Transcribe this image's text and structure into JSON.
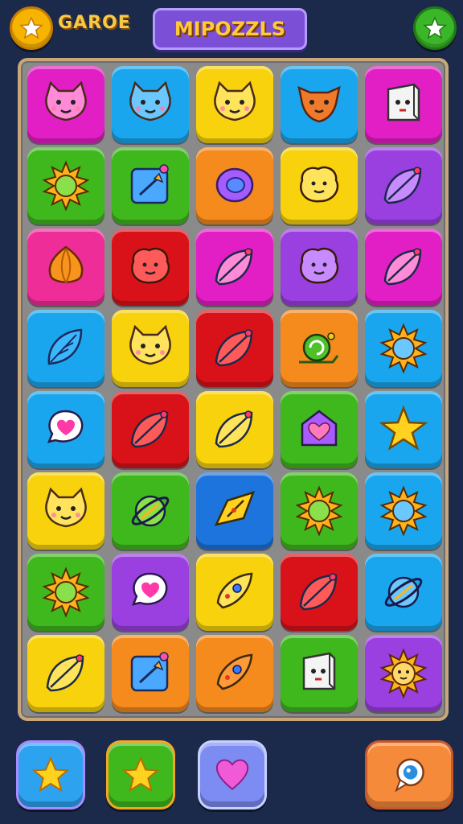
{
  "header": {
    "left_label": "GAROE",
    "title": "MIPOZZLS",
    "left_button_icon": "star-icon",
    "right_button_icon": "star-icon"
  },
  "board": {
    "rows": [
      [
        {
          "color": "magenta",
          "icon": "cat-face-icon"
        },
        {
          "color": "blue",
          "icon": "cat-face-icon"
        },
        {
          "color": "yellow",
          "icon": "cat-face-icon"
        },
        {
          "color": "blue",
          "icon": "fox-face-icon"
        },
        {
          "color": "magenta",
          "icon": "block-face-icon"
        }
      ],
      [
        {
          "color": "green",
          "icon": "sun-icon"
        },
        {
          "color": "green",
          "icon": "arrow-frame-icon"
        },
        {
          "color": "orange",
          "icon": "bubble-icon"
        },
        {
          "color": "yellow",
          "icon": "blob-face-icon"
        },
        {
          "color": "purple",
          "icon": "leaf-icon"
        }
      ],
      [
        {
          "color": "pink",
          "icon": "onion-icon"
        },
        {
          "color": "red",
          "icon": "blob-face-icon"
        },
        {
          "color": "magenta",
          "icon": "leaf-icon"
        },
        {
          "color": "purple",
          "icon": "blob-face-icon"
        },
        {
          "color": "magenta",
          "icon": "leaf-icon"
        }
      ],
      [
        {
          "color": "blue",
          "icon": "feather-icon"
        },
        {
          "color": "yellow",
          "icon": "cat-face-icon"
        },
        {
          "color": "red",
          "icon": "leaf-icon"
        },
        {
          "color": "orange",
          "icon": "snail-icon"
        },
        {
          "color": "blue",
          "icon": "sun-icon"
        }
      ],
      [
        {
          "color": "blue",
          "icon": "heart-bubble-icon"
        },
        {
          "color": "red",
          "icon": "leaf-icon"
        },
        {
          "color": "yellow",
          "icon": "leaf-icon"
        },
        {
          "color": "green",
          "icon": "heart-house-icon"
        },
        {
          "color": "blue",
          "icon": "star-icon"
        }
      ],
      [
        {
          "color": "yellow",
          "icon": "cat-face-icon"
        },
        {
          "color": "green",
          "icon": "planet-icon"
        },
        {
          "color": "darkblue",
          "icon": "arrow-icon"
        },
        {
          "color": "green",
          "icon": "sun-icon"
        },
        {
          "color": "blue",
          "icon": "sun-icon"
        }
      ],
      [
        {
          "color": "green",
          "icon": "sun-icon"
        },
        {
          "color": "purple",
          "icon": "heart-bubble-icon"
        },
        {
          "color": "yellow",
          "icon": "rocket-icon"
        },
        {
          "color": "red",
          "icon": "leaf-icon"
        },
        {
          "color": "blue",
          "icon": "planet-icon"
        }
      ],
      [
        {
          "color": "yellow",
          "icon": "leaf-icon"
        },
        {
          "color": "orange",
          "icon": "arrow-frame-icon"
        },
        {
          "color": "orange",
          "icon": "rocket-icon"
        },
        {
          "color": "green",
          "icon": "block-face-icon"
        },
        {
          "color": "purple",
          "icon": "sun-face-icon"
        }
      ]
    ]
  },
  "powerups": [
    {
      "id": "pu-star-blue",
      "icon": "star-icon"
    },
    {
      "id": "pu-star-green",
      "icon": "star-icon"
    },
    {
      "id": "pu-heart",
      "icon": "heart-icon"
    },
    {
      "id": "pu-chat",
      "icon": "chat-bubble-icon"
    }
  ],
  "colors": {
    "magenta": "#e21fc4",
    "blue": "#1aa6ee",
    "yellow": "#f7d20d",
    "green": "#3fb81e",
    "orange": "#f58a1d",
    "purple": "#9a3fe0",
    "red": "#d9121a",
    "pink": "#ef2d98",
    "darkblue": "#1d74dd",
    "background": "#1b2a4a",
    "board": "#8a8a8a"
  }
}
